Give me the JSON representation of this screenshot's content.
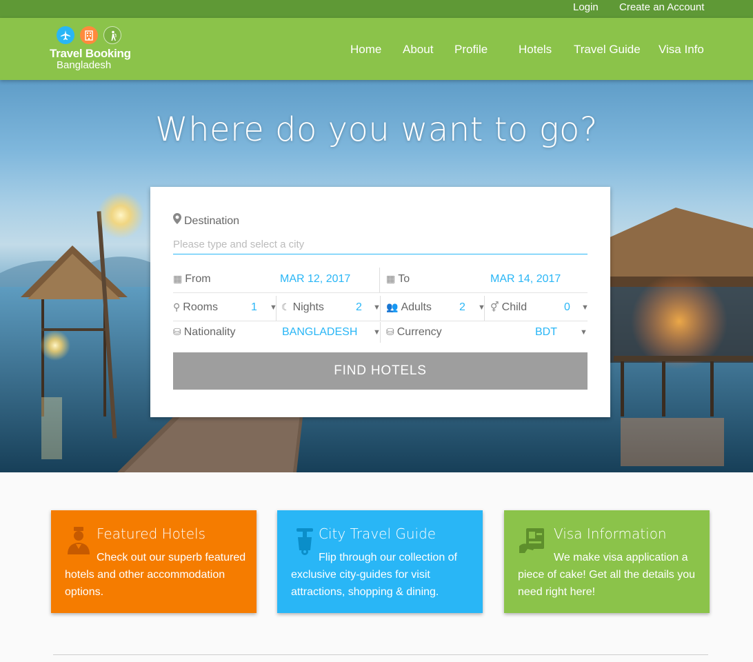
{
  "topbar": {
    "login": "Login",
    "create_account": "Create an Account"
  },
  "logo": {
    "line1": "Travel Booking",
    "line2": "Bangladesh"
  },
  "nav": [
    {
      "label": "Home"
    },
    {
      "label": "About"
    },
    {
      "label": "Profile"
    },
    {
      "label": "Hotels"
    },
    {
      "label": "Travel Guide"
    },
    {
      "label": "Visa Info"
    }
  ],
  "hero": {
    "title": "Where do you want to go?"
  },
  "search": {
    "destination_label": "Destination",
    "destination_placeholder": "Please type and select a city",
    "destination_value": "",
    "from_label": "From",
    "from_value": "MAR 12, 2017",
    "to_label": "To",
    "to_value": "MAR 14, 2017",
    "rooms_label": "Rooms",
    "rooms_value": "1",
    "nights_label": "Nights",
    "nights_value": "2",
    "adults_label": "Adults",
    "adults_value": "2",
    "child_label": "Child",
    "child_value": "0",
    "nationality_label": "Nationality",
    "nationality_value": "BANGLADESH",
    "currency_label": "Currency",
    "currency_value": "BDT",
    "find_button": "FIND HOTELS"
  },
  "features": [
    {
      "title": "Featured Hotels",
      "text": "Check out our superb featured hotels and other accommodation options.",
      "color": "#f57c00",
      "icon": "bellboy-icon"
    },
    {
      "title": "City Travel Guide",
      "text": "Flip through our collection of exclusive city-guides for visit attractions, shopping & dining.",
      "color": "#29b6f6",
      "icon": "scooter-icon"
    },
    {
      "title": "Visa Information",
      "text": "We make visa application a piece of cake! Get all the details you need right here!",
      "color": "#8bc34a",
      "icon": "passport-icon"
    }
  ],
  "colors": {
    "topbar": "#5f9936",
    "header": "#8bc34a",
    "accent": "#29b6f6",
    "button": "#9e9e9e"
  }
}
